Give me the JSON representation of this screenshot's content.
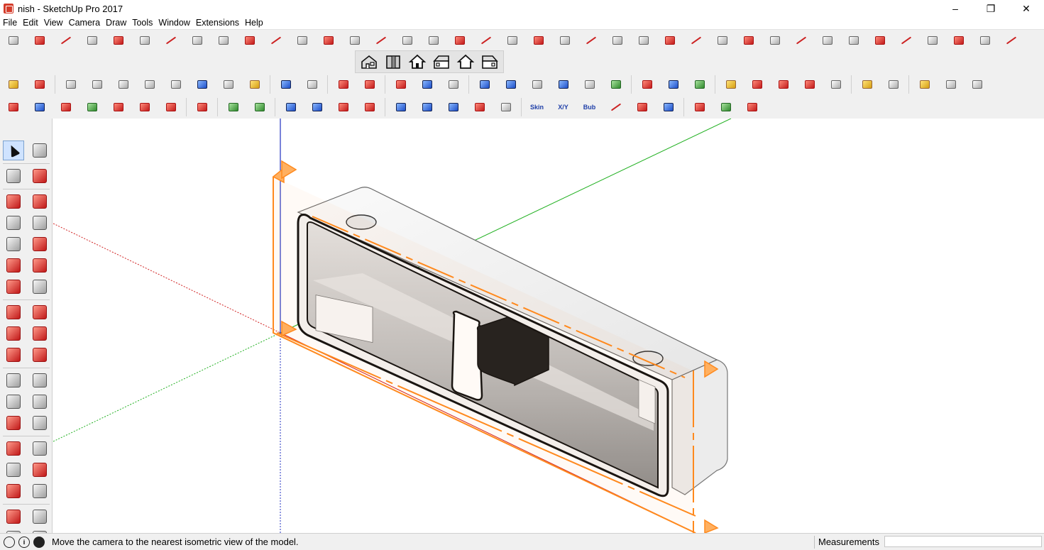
{
  "window": {
    "title": "nish - SketchUp Pro 2017",
    "app_icon": "sketchup-logo-icon",
    "controls": {
      "minimize": "–",
      "maximize": "❐",
      "close": "✕"
    }
  },
  "menu": {
    "items": [
      "File",
      "Edit",
      "View",
      "Camera",
      "Draw",
      "Tools",
      "Window",
      "Extensions",
      "Help"
    ]
  },
  "toolbars": {
    "row1_icon_count": 39,
    "views": [
      {
        "name": "iso-view-icon",
        "glyph": "⌂"
      },
      {
        "name": "top-view-icon",
        "glyph": "▣"
      },
      {
        "name": "front-view-icon",
        "glyph": "⌂"
      },
      {
        "name": "right-view-icon",
        "glyph": "⌂"
      },
      {
        "name": "back-view-icon",
        "glyph": "⌂"
      },
      {
        "name": "left-view-icon",
        "glyph": "⌂"
      }
    ],
    "row4_text_buttons": [
      "Skin",
      "X/Y",
      "Bub"
    ]
  },
  "status": {
    "message": "Move the camera to the nearest isometric view of the model.",
    "help_glyph": "?",
    "info_glyph": "i",
    "measurements_label": "Measurements",
    "measurements_value": ""
  },
  "colors": {
    "axis_red": "#d02020",
    "axis_green": "#20b020",
    "axis_blue": "#2030c0",
    "section_orange": "#ff8a1e",
    "toolbar_bg": "#f0f0f0"
  }
}
